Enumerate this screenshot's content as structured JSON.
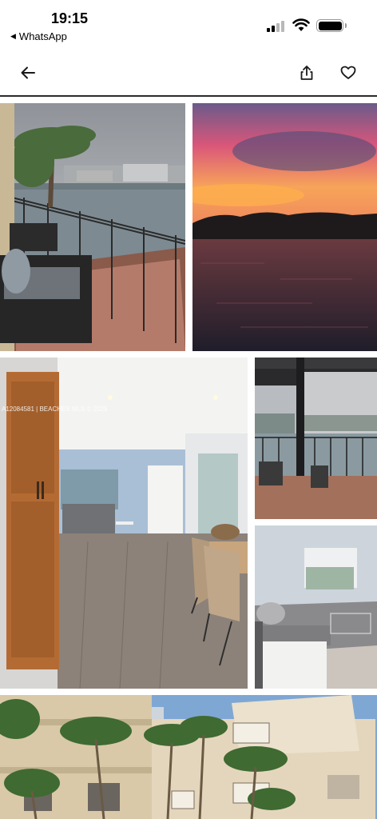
{
  "status_bar": {
    "time": "19:15",
    "back_app_label": "WhatsApp",
    "back_icon": "left-triangle-icon",
    "signal_icon": "cellular-signal-icon",
    "wifi_icon": "wifi-icon",
    "battery_icon": "battery-icon"
  },
  "nav": {
    "back_icon": "arrow-left-icon",
    "share_icon": "share-icon",
    "favorite_icon": "heart-icon"
  },
  "gallery": {
    "photos": [
      "balcony-waterfront-photo",
      "sunset-over-water-photo",
      "living-room-hallway-photo",
      "balcony-view-photo",
      "living-room-sofa-photo",
      "building-exterior-palms-photo"
    ],
    "watermark": "A12084581 | BEACHES MLS © 2025"
  },
  "colors": {
    "divider": "#2b2b2b",
    "icon": "#1a1a1a"
  }
}
